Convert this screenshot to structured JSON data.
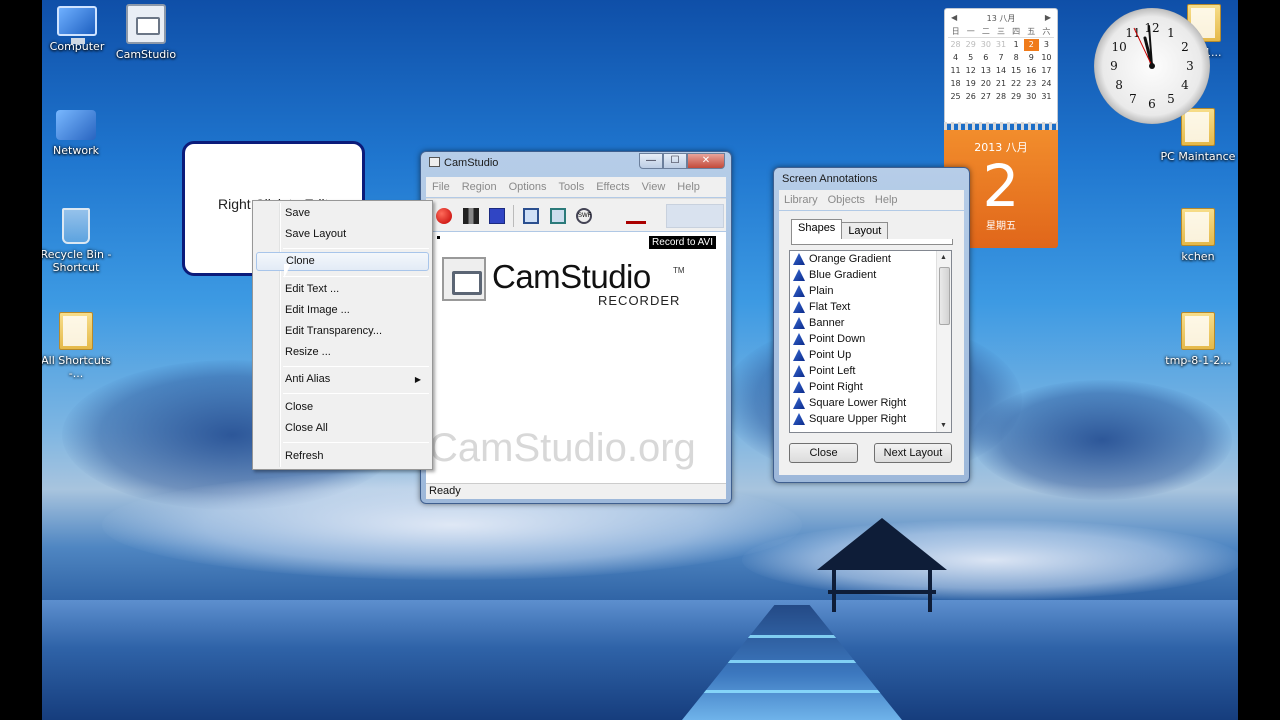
{
  "desktop_icons": [
    {
      "id": "computer",
      "label": "Computer"
    },
    {
      "id": "camstudio",
      "label": "CamStudio"
    },
    {
      "id": "network",
      "label": "Network"
    },
    {
      "id": "recycle",
      "label": "Recycle Bin - Shortcut"
    },
    {
      "id": "all_shortcuts",
      "label": "All Shortcuts -..."
    },
    {
      "id": "folder_01",
      "label": "...01..."
    },
    {
      "id": "pc_maintance",
      "label": "PC Maintance"
    },
    {
      "id": "kchen",
      "label": "kchen"
    },
    {
      "id": "tmp",
      "label": "tmp-8-1-2..."
    }
  ],
  "calendar": {
    "header": "13 八月",
    "prev": "◀",
    "next": "▶",
    "weekdays": [
      "日",
      "一",
      "二",
      "三",
      "四",
      "五",
      "六"
    ],
    "days": [
      "28",
      "29",
      "30",
      "31",
      "1",
      "2",
      "3",
      "4",
      "5",
      "6",
      "7",
      "8",
      "9",
      "10",
      "11",
      "12",
      "13",
      "14",
      "15",
      "16",
      "17",
      "18",
      "19",
      "20",
      "21",
      "22",
      "23",
      "24",
      "25",
      "26",
      "27",
      "28",
      "29",
      "30",
      "31"
    ],
    "today": "2",
    "big_year_month": "2013 八月",
    "big_day": "2",
    "big_weekday": "星期五"
  },
  "clock": {
    "numbers": [
      "12",
      "1",
      "2",
      "3",
      "4",
      "5",
      "6",
      "7",
      "8",
      "9",
      "10",
      "11"
    ]
  },
  "note": {
    "text": "Right Click to Edit"
  },
  "context_menu": {
    "items": [
      "Save",
      "Save Layout",
      "Clone",
      "Edit Text ...",
      "Edit Image ...",
      "Edit Transparency...",
      "Resize ...",
      "Anti Alias",
      "Close",
      "Close All",
      "Refresh"
    ],
    "highlighted": "Clone",
    "submenu_arrow": "▶"
  },
  "camstudio": {
    "title": "CamStudio",
    "controls": {
      "minimize": "—",
      "maximize": "☐",
      "close": "✕"
    },
    "menu": [
      "File",
      "Region",
      "Options",
      "Tools",
      "Effects",
      "View",
      "Help"
    ],
    "toolbar_swf": "SWF",
    "record_badge": "Record to AVI",
    "logo_text": "CamStudio",
    "logo_tm": "TM",
    "logo_sub": "RECORDER",
    "watermark": "CamStudio.org",
    "status": "Ready"
  },
  "annotations": {
    "title": "Screen Annotations",
    "menu": [
      "Library",
      "Objects",
      "Help"
    ],
    "tabs": [
      "Shapes",
      "Layout"
    ],
    "items": [
      "Orange Gradient",
      "Blue Gradient",
      "Plain",
      "Flat Text",
      "Banner",
      "Point Down",
      "Point Up",
      "Point Left",
      "Point Right",
      "Square Lower Right",
      "Square Upper Right"
    ],
    "close_button": "Close",
    "next_button": "Next Layout"
  }
}
